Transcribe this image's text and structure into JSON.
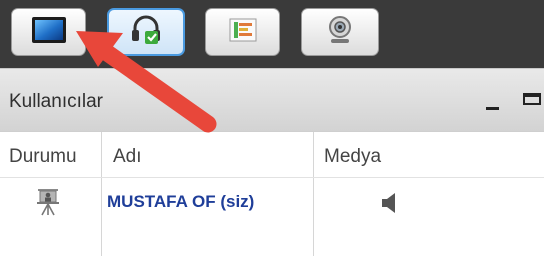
{
  "toolbar": {
    "buttons": [
      {
        "name": "desktop-share-button",
        "icon": "monitor-icon",
        "active": false
      },
      {
        "name": "audio-button",
        "icon": "headset-icon",
        "active": true
      },
      {
        "name": "presentation-button",
        "icon": "layout-icon",
        "active": false
      },
      {
        "name": "webcam-button",
        "icon": "webcam-icon",
        "active": false
      }
    ]
  },
  "panel": {
    "title": "Kullanıcılar",
    "columns": [
      "Durumu",
      "Adı",
      "Medya"
    ]
  },
  "users": [
    {
      "status_icon": "presenter-icon",
      "name": "MUSTAFA OF (siz)",
      "media_icon": "speaker-icon"
    }
  ],
  "annotation": {
    "arrow_color": "#e8473a"
  },
  "colors": {
    "name_text": "#1f3e99",
    "active_border": "#4a9ae0"
  }
}
